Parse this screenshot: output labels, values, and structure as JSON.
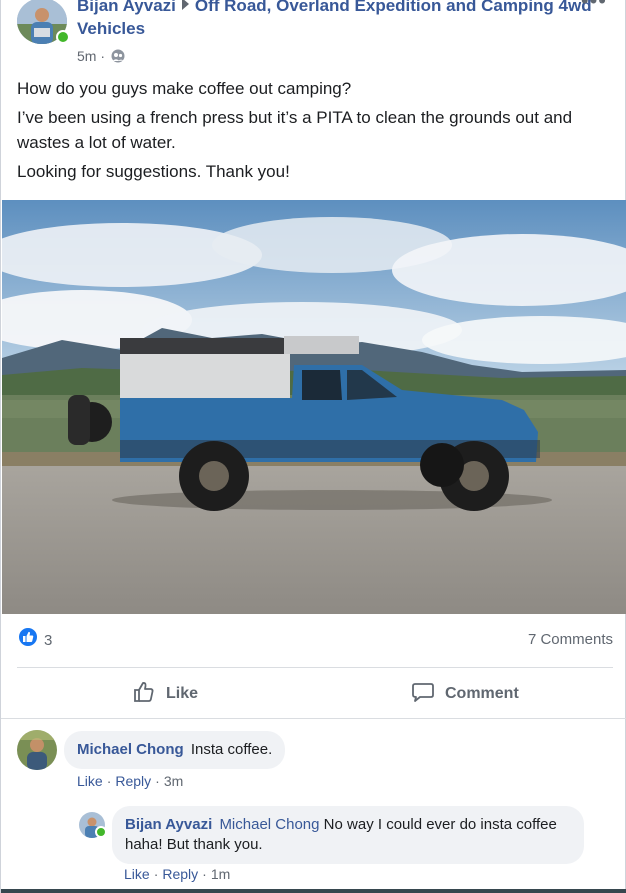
{
  "post": {
    "author": "Bijan Ayvazi",
    "group": "Off Road, Overland Expedition and Camping 4wd Vehicles",
    "time": "5m",
    "time_sep": "·",
    "more": "•••",
    "lines": [
      "How do you guys make coffee out camping?",
      "I’ve been using a french press but it’s a PITA to clean the grounds out and wastes a lot of water.",
      "Looking for suggestions. Thank you!"
    ]
  },
  "stats": {
    "likes": "3",
    "comments": "7 Comments"
  },
  "actions": {
    "like": "Like",
    "comment": "Comment"
  },
  "comments": [
    {
      "author": "Michael Chong",
      "text": "Insta coffee.",
      "like": "Like",
      "reply": "Reply",
      "time": "3m"
    },
    {
      "author": "Bijan Ayvazi",
      "mention": "Michael Chong",
      "text": "No way I could ever do insta coffee haha! But thank you.",
      "like": "Like",
      "reply": "Reply",
      "time": "1m"
    }
  ],
  "colors": {
    "link": "#385898",
    "accent": "#1877f2",
    "online": "#42b72a",
    "truck": "#2f6fa8"
  }
}
